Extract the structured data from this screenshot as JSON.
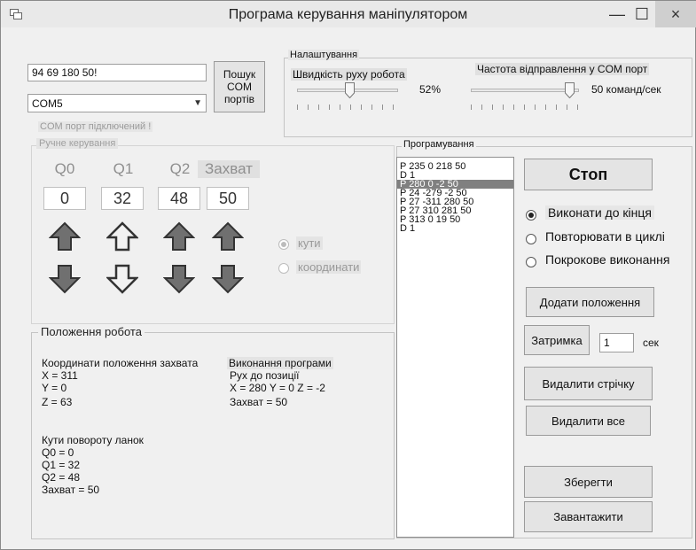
{
  "window": {
    "title": "Програма керування маніпулятором",
    "minimize": "—",
    "maximize": "☐",
    "close": "×"
  },
  "connection": {
    "command_value": "94 69 180 50!",
    "port_value": "COM5",
    "search_button": "Пошук COM портів",
    "status": "COM порт підключений !"
  },
  "settings": {
    "group_title": "Налаштування",
    "speed_label": "Швидкість руху робота",
    "speed_value": "52%",
    "speed_level": 0.52,
    "freq_label": "Частота відправлення у COM порт",
    "freq_value": "50 команд/сек"
  },
  "manual": {
    "group_title": "Ручне керування",
    "columns": [
      {
        "head": "Q0",
        "value": "0"
      },
      {
        "head": "Q1",
        "value": "32"
      },
      {
        "head": "Q2",
        "value": "48"
      },
      {
        "head": "Захват",
        "value": "50"
      }
    ],
    "mode_angles": "кути",
    "mode_coords": "координати"
  },
  "position": {
    "group_title": "Положення робота",
    "coords_title": "Координати положення захвата",
    "x": "X = 311",
    "y": "Y = 0",
    "z": "Z = 63",
    "angles_title": "Кути повороту ланок",
    "q0": "Q0 = 0",
    "q1": "Q1 = 32",
    "q2": "Q2 = 48",
    "grip": "Захват = 50",
    "exec_title": "Виконання програми",
    "move_to": "Рух до позиції",
    "target": "X = 280 Y = 0 Z = -2",
    "exec_grip": "Захват = 50"
  },
  "program": {
    "group_title": "Програмування",
    "lines": [
      "P 235 0 218 50",
      "D 1",
      "P 280 0 -2 50",
      "P 24 -279 -2 50",
      "P 27 -311 280 50",
      "P 27 310 281 50",
      "P 313 0 19 50",
      "D 1"
    ],
    "selected_index": 2,
    "stop_button": "Стоп",
    "run_once": "Виконати до кінця",
    "run_loop": "Повторювати в циклі",
    "run_step": "Покрокове виконання",
    "add_button": "Додати положення",
    "delay_button": "Затримка",
    "delay_value": "1",
    "delay_unit": "сек",
    "delete_line_button": "Видалити стрічку",
    "delete_all_button": "Видалити все",
    "save_button": "Зберегти",
    "load_button": "Завантажити"
  }
}
